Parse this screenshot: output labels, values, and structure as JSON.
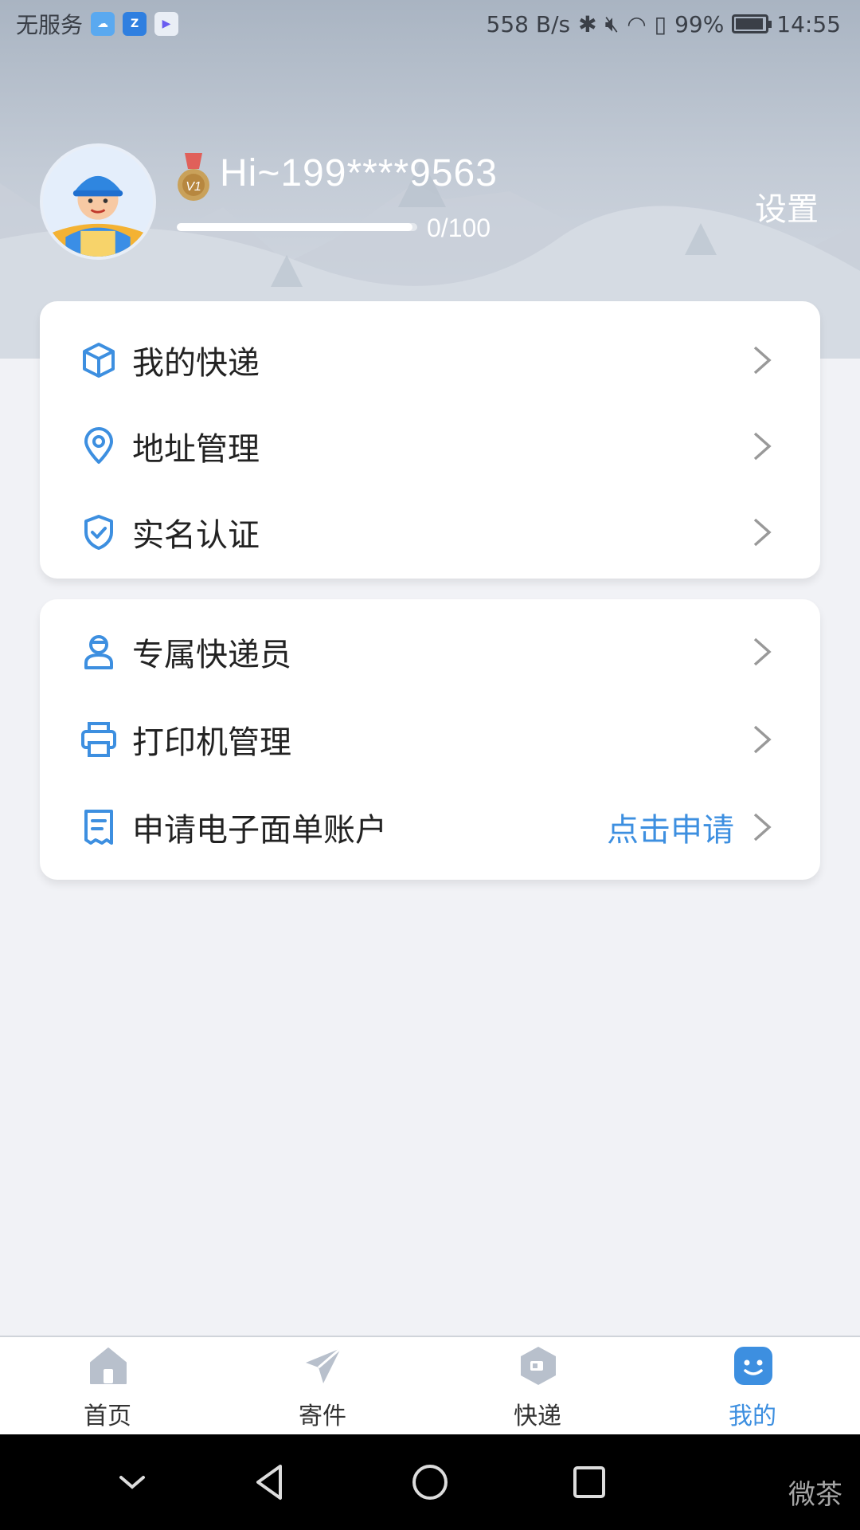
{
  "status_bar": {
    "carrier": "无服务",
    "network_speed": "558 B/s",
    "battery": "99%",
    "time": "14:55"
  },
  "profile": {
    "greeting": "Hi~199****9563",
    "progress_text": "0/100",
    "progress_fraction": 0.98,
    "settings_label": "设置",
    "medal_text": "V1"
  },
  "menu_group_1": [
    {
      "label": "我的快递",
      "icon": "box-icon"
    },
    {
      "label": "地址管理",
      "icon": "location-pin-icon"
    },
    {
      "label": "实名认证",
      "icon": "shield-check-icon"
    }
  ],
  "menu_group_2": [
    {
      "label": "专属快递员",
      "icon": "courier-icon"
    },
    {
      "label": "打印机管理",
      "icon": "printer-icon"
    },
    {
      "label": "申请电子面单账户",
      "icon": "receipt-icon",
      "action": "点击申请"
    }
  ],
  "tabs": [
    {
      "label": "首页",
      "icon": "home-icon",
      "active": false
    },
    {
      "label": "寄件",
      "icon": "send-plane-icon",
      "active": false
    },
    {
      "label": "快递",
      "icon": "package-icon",
      "active": false
    },
    {
      "label": "我的",
      "icon": "smiley-icon",
      "active": true
    }
  ],
  "colors": {
    "accent": "#3d8fe0",
    "inactive_icon": "#b8c0cc"
  },
  "watermark": "微茶"
}
